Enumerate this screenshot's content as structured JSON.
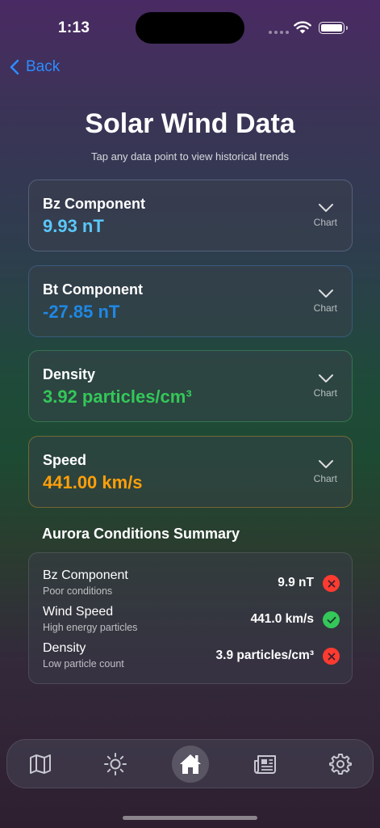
{
  "status": {
    "time": "1:13"
  },
  "nav": {
    "back_label": "Back"
  },
  "header": {
    "title": "Solar Wind Data",
    "subtitle": "Tap any data point to view historical trends"
  },
  "cards": [
    {
      "label": "Bz Component",
      "value": "9.93 nT",
      "chart_label": "Chart",
      "color": "#5ac8fa"
    },
    {
      "label": "Bt Component",
      "value": "-27.85 nT",
      "chart_label": "Chart",
      "color": "#1e88e5"
    },
    {
      "label": "Density",
      "value": "3.92 particles/cm³",
      "chart_label": "Chart",
      "color": "#34c759"
    },
    {
      "label": "Speed",
      "value": "441.00 km/s",
      "chart_label": "Chart",
      "color": "#ff9f0a"
    }
  ],
  "summary": {
    "heading": "Aurora Conditions Summary",
    "rows": [
      {
        "label": "Bz Component",
        "desc": "Poor conditions",
        "value": "9.9 nT",
        "status": "bad"
      },
      {
        "label": "Wind Speed",
        "desc": "High energy particles",
        "value": "441.0 km/s",
        "status": "good"
      },
      {
        "label": "Density",
        "desc": "Low particle count",
        "value": "3.9 particles/cm³",
        "status": "bad"
      }
    ]
  },
  "colors": {
    "accent": "#2d8cff",
    "good": "#34c759",
    "bad": "#ff3b30"
  },
  "tabs": [
    {
      "icon": "map-icon",
      "active": false
    },
    {
      "icon": "sun-icon",
      "active": false
    },
    {
      "icon": "home-icon",
      "active": true
    },
    {
      "icon": "newspaper-icon",
      "active": false
    },
    {
      "icon": "gear-icon",
      "active": false
    }
  ]
}
